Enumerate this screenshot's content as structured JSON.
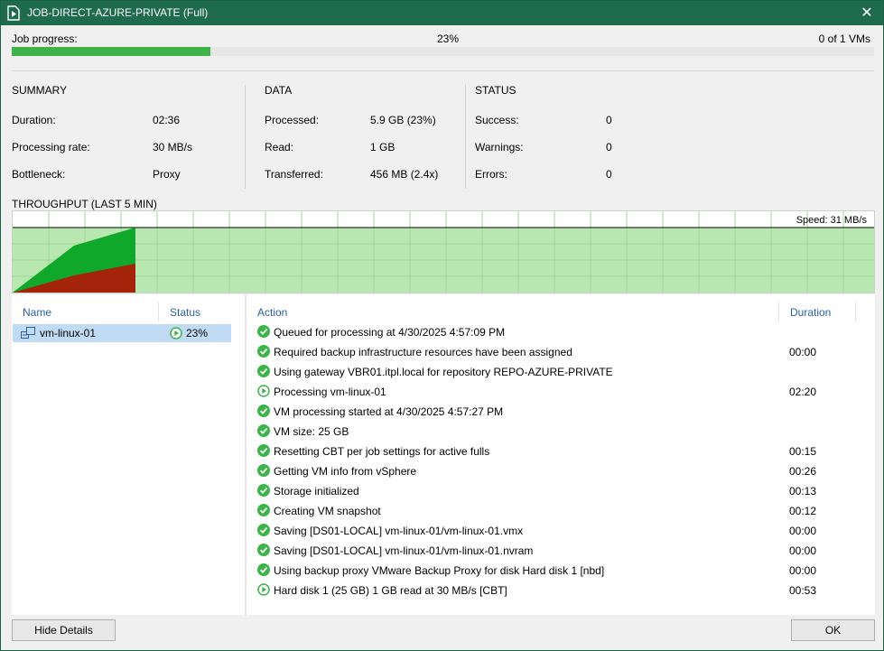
{
  "window": {
    "title": "JOB-DIRECT-AZURE-PRIVATE (Full)",
    "close_glyph": "✕"
  },
  "progress": {
    "label": "Job progress:",
    "percent_text": "23%",
    "percent": 23,
    "vms": "0 of 1 VMs"
  },
  "summary": {
    "title": "SUMMARY",
    "rows": [
      {
        "label": "Duration:",
        "value": "02:36"
      },
      {
        "label": "Processing rate:",
        "value": "30 MB/s"
      },
      {
        "label": "Bottleneck:",
        "value": "Proxy"
      }
    ]
  },
  "data_section": {
    "title": "DATA",
    "rows": [
      {
        "label": "Processed:",
        "value": "5.9 GB (23%)"
      },
      {
        "label": "Read:",
        "value": "1 GB"
      },
      {
        "label": "Transferred:",
        "value": "456 MB (2.4x)"
      }
    ]
  },
  "status_section": {
    "title": "STATUS",
    "rows": [
      {
        "label": "Success:",
        "value": "0"
      },
      {
        "label": "Warnings:",
        "value": "0"
      },
      {
        "label": "Errors:",
        "value": "0"
      }
    ]
  },
  "throughput": {
    "title": "THROUGHPUT (LAST 5 MIN)",
    "speed": "Speed: 31 MB/s"
  },
  "vm_list": {
    "headers": {
      "name": "Name",
      "status": "Status"
    },
    "items": [
      {
        "name": "vm-linux-01",
        "status": "23%"
      }
    ]
  },
  "actions": {
    "headers": {
      "action": "Action",
      "duration": "Duration"
    },
    "items": [
      {
        "icon": "success-icon",
        "text": "Queued for processing at 4/30/2025 4:57:09 PM",
        "duration": ""
      },
      {
        "icon": "success-icon",
        "text": "Required backup infrastructure resources have been assigned",
        "duration": "00:00"
      },
      {
        "icon": "success-icon",
        "text": "Using gateway VBR01.itpl.local for repository REPO-AZURE-PRIVATE",
        "duration": ""
      },
      {
        "icon": "running-icon",
        "text": "Processing vm-linux-01",
        "duration": "02:20"
      },
      {
        "icon": "success-icon",
        "text": "VM processing started at 4/30/2025 4:57:27 PM",
        "duration": ""
      },
      {
        "icon": "success-icon",
        "text": "VM size: 25 GB",
        "duration": ""
      },
      {
        "icon": "success-icon",
        "text": "Resetting CBT per job settings for active fulls",
        "duration": "00:15"
      },
      {
        "icon": "success-icon",
        "text": "Getting VM info from vSphere",
        "duration": "00:26"
      },
      {
        "icon": "success-icon",
        "text": "Storage initialized",
        "duration": "00:13"
      },
      {
        "icon": "success-icon",
        "text": "Creating VM snapshot",
        "duration": "00:12"
      },
      {
        "icon": "success-icon",
        "text": "Saving [DS01-LOCAL] vm-linux-01/vm-linux-01.vmx",
        "duration": "00:00"
      },
      {
        "icon": "success-icon",
        "text": "Saving [DS01-LOCAL] vm-linux-01/vm-linux-01.nvram",
        "duration": "00:00"
      },
      {
        "icon": "success-icon",
        "text": "Using backup proxy VMware Backup Proxy for disk Hard disk 1 [nbd]",
        "duration": "00:00"
      },
      {
        "icon": "running-icon",
        "text": "Hard disk 1 (25 GB) 1 GB read at 30 MB/s [CBT]",
        "duration": "00:53"
      }
    ]
  },
  "buttons": {
    "hide_details": "Hide Details",
    "ok": "OK"
  },
  "colors": {
    "titlebar": "#1e6b4f",
    "progress": "#3db34a",
    "chart_bg": "#b8e8b0",
    "read": "#10a82a",
    "transfer": "#a3240a",
    "link": "#2b5fa5",
    "selection": "#c1dbf5"
  }
}
